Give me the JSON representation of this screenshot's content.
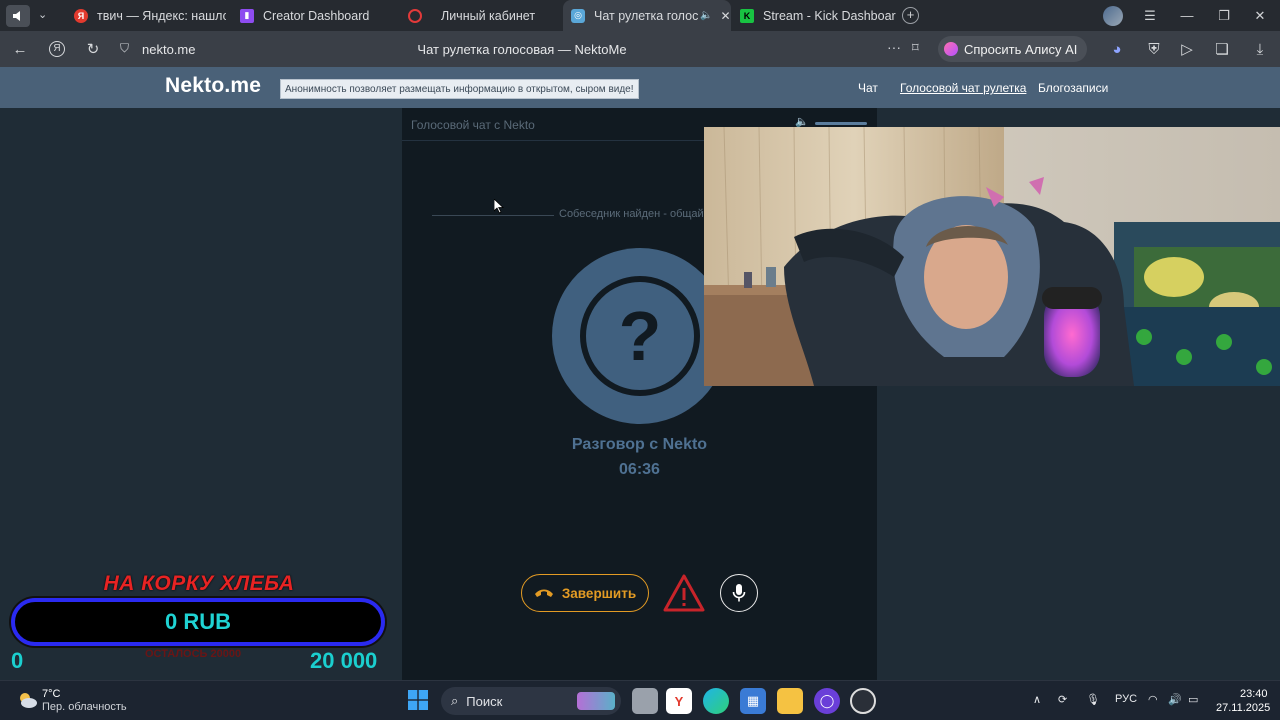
{
  "browser": {
    "tabs": [
      {
        "label": "твич — Яндекс: нашлось",
        "icon": "yandex-icon"
      },
      {
        "label": "Creator Dashboard",
        "icon": "twitch-icon"
      },
      {
        "label": "Личный кабинет",
        "icon": "circle-icon"
      },
      {
        "label": "Чат рулетка голосов",
        "icon": "nekto-icon",
        "active": true
      },
      {
        "label": "Stream - Kick Dashboard",
        "icon": "kick-icon"
      }
    ],
    "url": "nekto.me",
    "page_title": "Чат рулетка голосовая — NektoMe",
    "alisa_label": "Спросить Алису AI"
  },
  "site": {
    "logo": "Nekto.me",
    "slogan": "Анонимность позволяет размещать информацию в открытом, сыром виде!",
    "nav": [
      "Чат",
      "Голосовой чат рулетка",
      "Блогозаписи"
    ]
  },
  "chat": {
    "title": "Голосовой чат с Nekto",
    "found_text": "Собеседник найден - общайтесь",
    "avatar_glyph": "?",
    "conversation_label": "Разговор с Nekto",
    "timer": "06:36",
    "end_button": "Завершить"
  },
  "donation": {
    "title": "НА КОРКУ ХЛЕБА",
    "amount": "0 RUB",
    "min": "0",
    "max": "20 000",
    "subtitle": "ОСТАЛОСЬ 20000"
  },
  "taskbar": {
    "weather_temp": "7°C",
    "weather_desc": "Пер. облачность",
    "search_placeholder": "Поиск",
    "lang": "РУС",
    "time": "23:40",
    "date": "27.11.2025"
  },
  "colors": {
    "accent_orange": "#e39b24",
    "avatar_blue": "#40607f",
    "header_blue": "#4a6178",
    "donation_cyan": "#1bcfcf",
    "donation_red": "#e82323"
  }
}
